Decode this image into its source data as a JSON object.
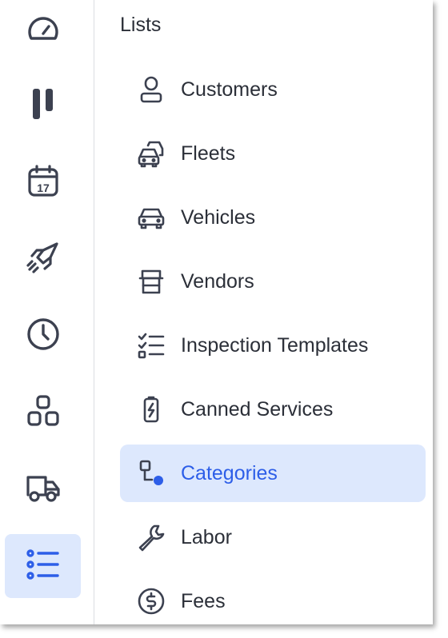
{
  "colors": {
    "accent": "#2d5ee8",
    "active_background": "#dde8fd",
    "icon": "#3c4150",
    "text": "#2b2f38",
    "divider": "#dcdde1"
  },
  "rail": {
    "items": [
      {
        "icon": "gauge-icon"
      },
      {
        "icon": "pause-bars-icon"
      },
      {
        "icon": "calendar-icon",
        "icon_text": "17"
      },
      {
        "icon": "rocket-icon"
      },
      {
        "icon": "clock-icon"
      },
      {
        "icon": "shapes-icon"
      },
      {
        "icon": "truck-icon"
      },
      {
        "icon": "list-icon",
        "active": true
      }
    ]
  },
  "lists_panel": {
    "title": "Lists",
    "items": [
      {
        "label": "Customers",
        "icon": "user-icon"
      },
      {
        "label": "Fleets",
        "icon": "fleet-cars-icon"
      },
      {
        "label": "Vehicles",
        "icon": "car-icon"
      },
      {
        "label": "Vendors",
        "icon": "storefront-icon"
      },
      {
        "label": "Inspection Templates",
        "icon": "checklist-icon"
      },
      {
        "label": "Canned Services",
        "icon": "battery-bolt-icon"
      },
      {
        "label": "Categories",
        "icon": "categories-icon",
        "active": true
      },
      {
        "label": "Labor",
        "icon": "wrench-icon"
      },
      {
        "label": "Fees",
        "icon": "dollar-circle-icon"
      }
    ]
  }
}
